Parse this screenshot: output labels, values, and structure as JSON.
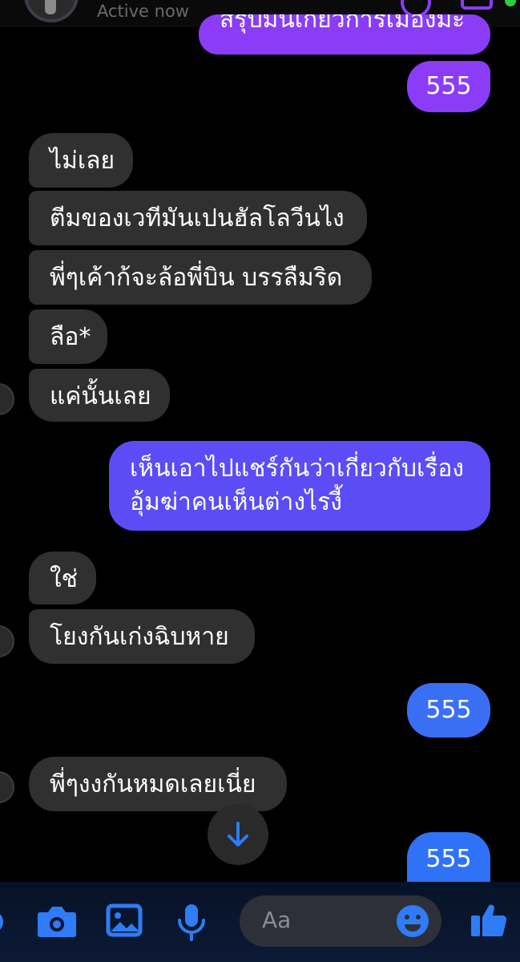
{
  "header": {
    "status": "Active now"
  },
  "messages": [
    {
      "id": "m1",
      "side": "out",
      "text": "สรุปมันเกี่ยวการเมืองมะ"
    },
    {
      "id": "m2",
      "side": "out",
      "text": "555"
    },
    {
      "id": "m3",
      "side": "in",
      "text": "ไม่เลย"
    },
    {
      "id": "m4",
      "side": "in",
      "text": "ตีมของเวทีมันเปนฮัลโลวีนไง"
    },
    {
      "id": "m5",
      "side": "in",
      "text": "พี่ๆเค้าก้จะล้อพี่บิน บรรลืมริด"
    },
    {
      "id": "m6",
      "side": "in",
      "text": "ลือ*"
    },
    {
      "id": "m7",
      "side": "in",
      "text": "แค่นั้นเลย"
    },
    {
      "id": "m8",
      "side": "out",
      "lines": [
        "เห็นเอาไปแชร์กันว่าเกี่ยวกับเรื่อง",
        "อุ้มฆ่าคนเห็นต่างไรงี้"
      ]
    },
    {
      "id": "m9",
      "side": "in",
      "text": "ใช่"
    },
    {
      "id": "m10",
      "side": "in",
      "text": "โยงกันเก่งฉิบหาย"
    },
    {
      "id": "m11",
      "side": "out",
      "text": "555"
    },
    {
      "id": "m12",
      "side": "in",
      "text": "พี่ๆงงกันหมดเลยเนี่ย"
    },
    {
      "id": "m13",
      "side": "out",
      "text": "555"
    }
  ],
  "composer": {
    "placeholder": "Aa",
    "icons": [
      "camera-icon",
      "image-icon",
      "microphone-icon",
      "emoji-icon",
      "thumbs-up-icon"
    ]
  },
  "colors": {
    "background": "#000000",
    "incoming_bubble": "#303030",
    "outgoing_purple": "#8a3cf6",
    "outgoing_indigo": "#5b4cf5",
    "outgoing_blue": "#3a6ef5",
    "accent": "#2f7cf6"
  }
}
